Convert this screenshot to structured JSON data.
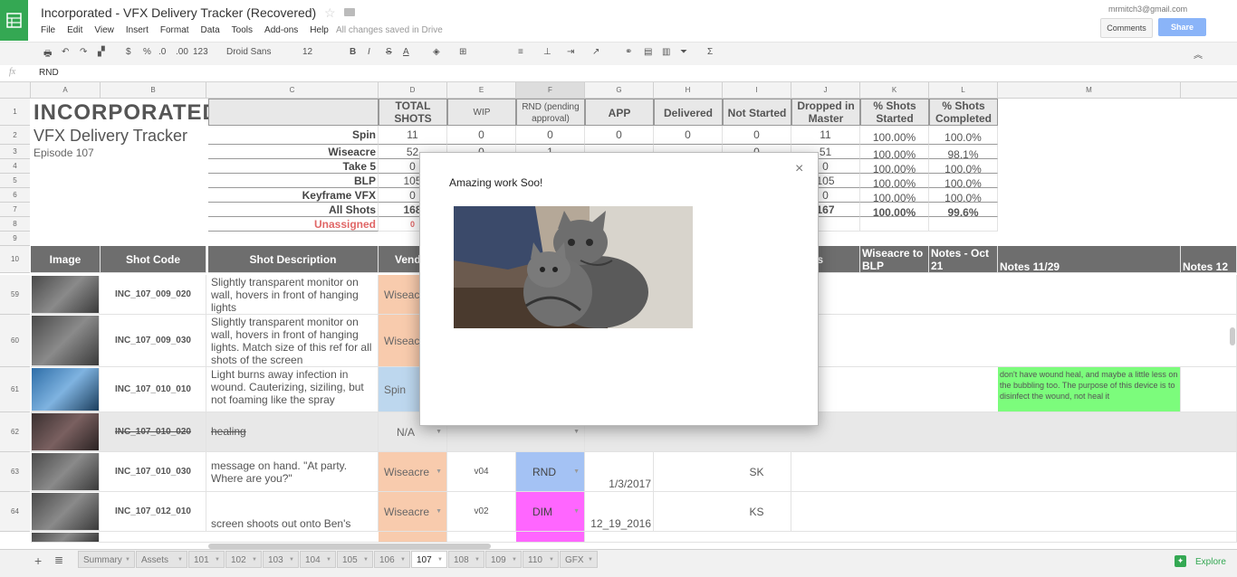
{
  "app": {
    "doc_title": "Incorporated  - VFX Delivery Tracker (Recovered)",
    "saved_status": "All changes saved in Drive",
    "account": "mrmitch3@gmail.com",
    "comments_label": "Comments",
    "share_label": "Share",
    "menu": [
      "File",
      "Edit",
      "View",
      "Insert",
      "Format",
      "Data",
      "Tools",
      "Add-ons",
      "Help"
    ]
  },
  "toolbar": {
    "currency": "$",
    "percent": "%",
    "dec_less": ".0",
    "dec_more": ".00",
    "format_more": "123",
    "font": "Droid Sans",
    "font_size": "12",
    "bold": "B",
    "italic": "I",
    "strike": "S",
    "text_color": "A"
  },
  "formula_bar": {
    "fx": "fx",
    "value": "RND"
  },
  "columns": [
    "A",
    "B",
    "C",
    "D",
    "E",
    "F",
    "G",
    "H",
    "I",
    "J",
    "K",
    "L",
    "M"
  ],
  "summary": {
    "title": "INCORPORATED",
    "subtitle": "VFX Delivery Tracker",
    "episode": "Episode 107",
    "headers": [
      "TOTAL SHOTS",
      "WIP",
      "RND (pending approval)",
      "APP",
      "Delivered",
      "Not Started",
      "Dropped in Master",
      "% Shots Started",
      "% Shots Completed"
    ],
    "rows": [
      {
        "label": "Spin",
        "vals": [
          "11",
          "0",
          "0",
          "0",
          "0",
          "0",
          "11",
          "100.00%",
          "100.0%"
        ]
      },
      {
        "label": "Wiseacre",
        "vals": [
          "52",
          "0",
          "1",
          "",
          "",
          "0",
          "51",
          "100.00%",
          "98.1%"
        ]
      },
      {
        "label": "Take 5",
        "vals": [
          "0",
          "",
          "",
          "",
          "",
          "",
          "0",
          "100.00%",
          "100.0%"
        ]
      },
      {
        "label": "BLP",
        "vals": [
          "105",
          "",
          "",
          "",
          "",
          "",
          "105",
          "100.00%",
          "100.0%"
        ]
      },
      {
        "label": "Keyframe VFX",
        "vals": [
          "0",
          "",
          "",
          "",
          "",
          "",
          "0",
          "100.00%",
          "100.0%"
        ]
      },
      {
        "label": "All Shots",
        "vals": [
          "168",
          "",
          "",
          "",
          "",
          "",
          "167",
          "100.00%",
          "99.6%"
        ]
      },
      {
        "label": "Unassigned",
        "vals": [
          "0",
          "",
          "",
          "",
          "",
          "",
          "",
          "",
          ""
        ]
      }
    ]
  },
  "row_numbers": [
    "1",
    "2",
    "3",
    "4",
    "5",
    "6",
    "7",
    "8",
    "9",
    "10",
    "59",
    "60",
    "61",
    "62",
    "63",
    "64"
  ],
  "table_headers": {
    "image": "Image",
    "shot_code": "Shot Code",
    "shot_desc": "Shot Description",
    "vendor": "Vend",
    "notes_cut": "s",
    "wiseacre_blp": "Wiseacre to BLP",
    "notes_oct": "Notes - Oct 21",
    "notes_1129": "Notes 11/29",
    "notes_12": "Notes 12"
  },
  "shots": [
    {
      "row": "59",
      "code": "INC_107_009_020",
      "desc": "Slightly transparent monitor on wall, hovers in front of hanging lights",
      "vendor": "Wiseacr",
      "status": "",
      "date": "",
      "who": "",
      "note": ""
    },
    {
      "row": "60",
      "code": "INC_107_009_030",
      "desc": "Slightly transparent monitor on wall, hovers in front of hanging lights.  Match size of this ref for all shots of the screen",
      "vendor": "Wiseacr",
      "status": "",
      "date": "",
      "who": "",
      "note": ""
    },
    {
      "row": "61",
      "code": "INC_107_010_010",
      "desc": "Light burns away infection in wound.  Cauterizing, siziling, but not foaming like the spray",
      "vendor": "Spin",
      "status": "",
      "date": "",
      "who": "",
      "note": "don't have wound heal, and maybe a little less on the bubbling too.  The purpose of this device is to disinfect the wound, not heal it"
    },
    {
      "row": "62",
      "code": "INC_107_010_020",
      "desc": "healing",
      "vendor": "N/A",
      "status": "",
      "date": "",
      "who": "",
      "note": ""
    },
    {
      "row": "63",
      "code": "INC_107_010_030",
      "desc": "message on hand. \"At party. Where are you?\"",
      "vendor": "Wiseacre",
      "version": "v04",
      "status": "RND",
      "date": "1/3/2017",
      "who": "SK",
      "note": ""
    },
    {
      "row": "64",
      "code": "INC_107_012_010",
      "desc": "screen shoots out onto Ben's hand",
      "vendor": "Wiseacre",
      "version": "v02",
      "status": "DIM",
      "date": "12_19_2016",
      "who": "KS",
      "note": ""
    }
  ],
  "modal": {
    "message": "Amazing work Soo!",
    "close": "×"
  },
  "sheet_tabs": [
    "Summary",
    "Assets",
    "101",
    "102",
    "103",
    "104",
    "105",
    "106",
    "107",
    "108",
    "109",
    "110",
    "GFX"
  ],
  "active_tab": "107",
  "explore_label": "Explore",
  "colors": {
    "wiseacre": "#f8cbad",
    "spin": "#bdd7ee",
    "rnd": "#a4c2f4",
    "dim": "#ff66ff",
    "note_green": "#7cfc7c",
    "header_gray": "#6e6e6e",
    "unassigned_red": "#e06666"
  }
}
